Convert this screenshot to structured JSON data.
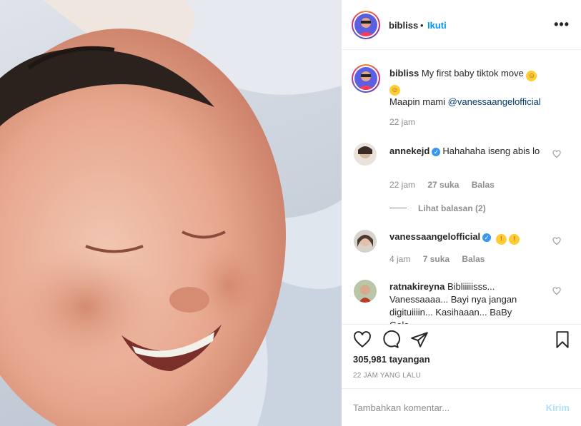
{
  "post": {
    "username": "bibliss",
    "dot": "•",
    "follow_label": "Ikuti",
    "more_label": "•••",
    "media_alt": "baby-video-frame"
  },
  "caption": {
    "username": "bibliss",
    "text": "My first baby tiktok move",
    "line2": "Maapin mami",
    "mention": "@vanessaangelofficial",
    "time": "22 jam"
  },
  "comments": [
    {
      "username": "annekejd",
      "verified": true,
      "text": "Hahahaha iseng abis lo",
      "time": "22 jam",
      "likes": "27 suka",
      "reply": "Balas",
      "view_replies": "Lihat balasan (2)"
    },
    {
      "username": "vanessaangelofficial",
      "verified": true,
      "text": "",
      "time": "4 jam",
      "likes": "7 suka",
      "reply": "Balas"
    },
    {
      "username": "ratnakireyna",
      "verified": false,
      "text": "Bibliiiiisss... Vanessaaaa... Bayi nya jangan digituiiiin... Kasihaaan... BaBy Gala"
    }
  ],
  "stats": {
    "views": "305,981 tayangan",
    "posted_ago": "22 JAM YANG LALU"
  },
  "add_comment": {
    "placeholder": "Tambahkan komentar...",
    "post_label": "Kirim"
  },
  "icons": {
    "like": "heart-icon",
    "comment": "comment-icon",
    "share": "paper-plane-icon",
    "save": "bookmark-icon"
  },
  "colors": {
    "link": "#0095f6",
    "mention": "#00376b",
    "muted": "#8e8e8e",
    "verified": "#3897f0"
  }
}
